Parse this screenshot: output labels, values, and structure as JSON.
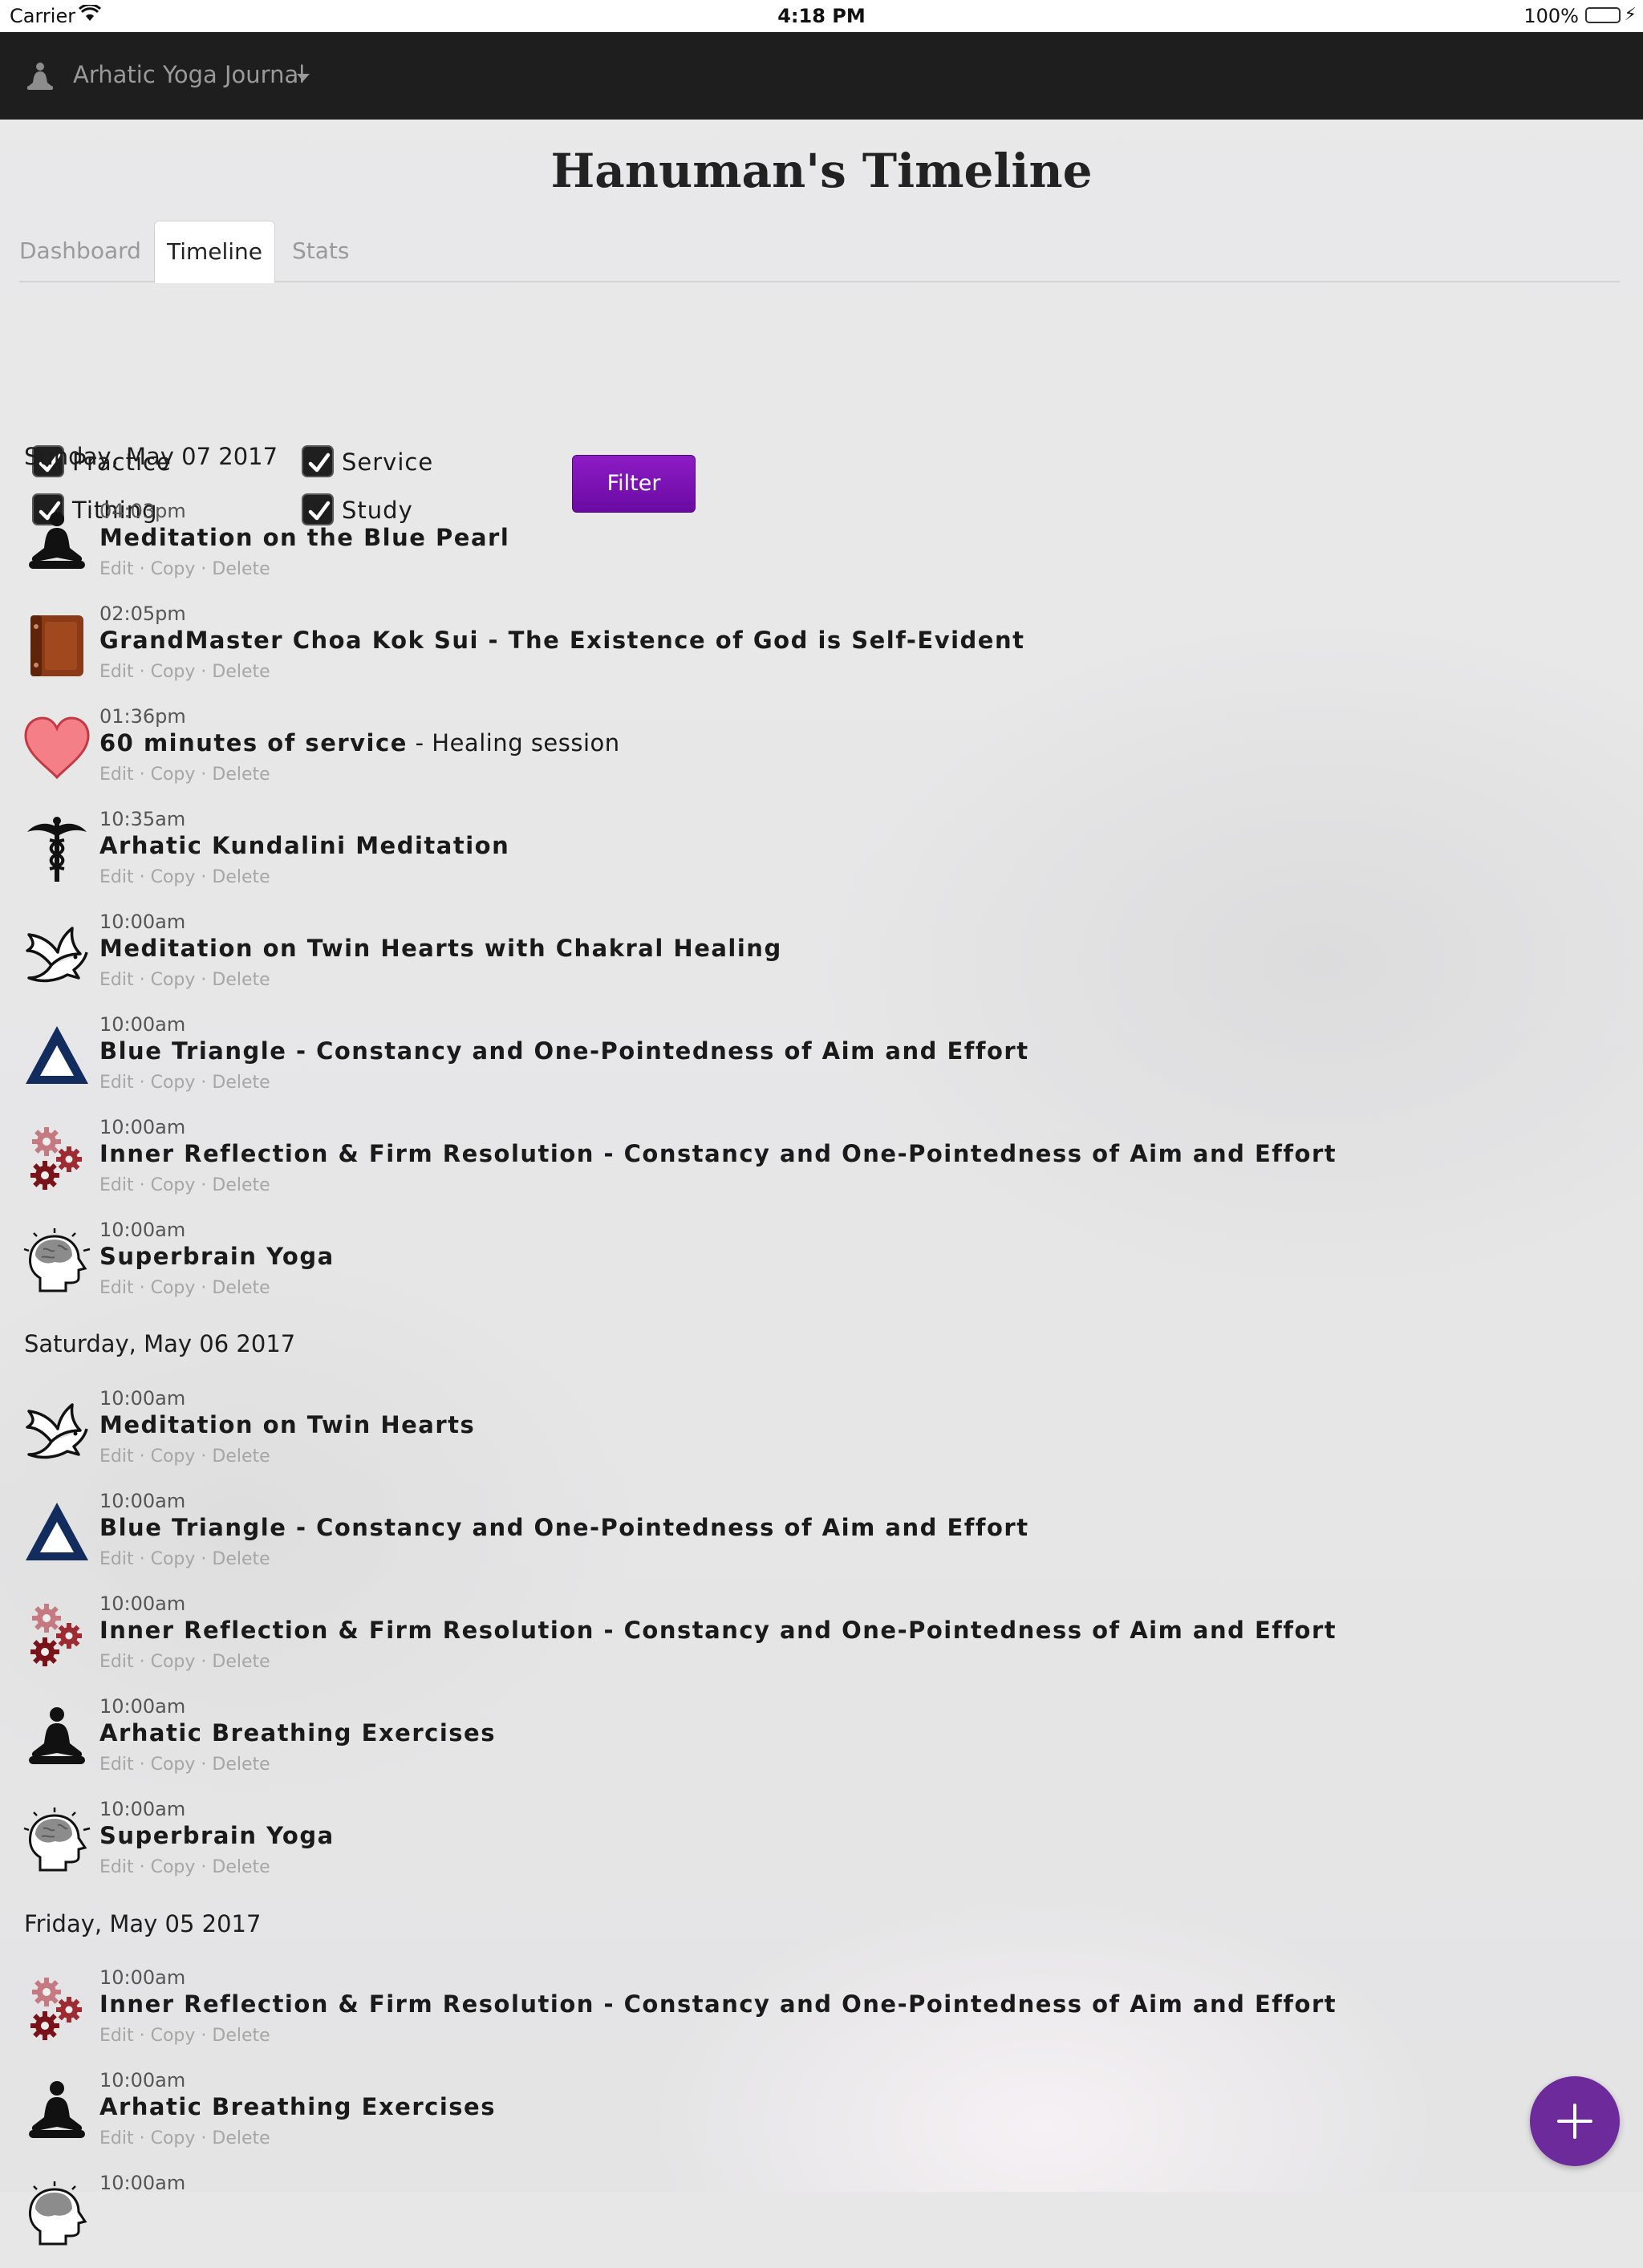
{
  "status_bar": {
    "carrier": "Carrier",
    "time": "4:18 PM",
    "battery": "100%"
  },
  "navbar": {
    "brand": "Arhatic Yoga Journal"
  },
  "page": {
    "title": "Hanuman's Timeline"
  },
  "tabs": [
    {
      "label": "Dashboard"
    },
    {
      "label": "Timeline"
    },
    {
      "label": "Stats"
    }
  ],
  "filters": {
    "practice": "Practice",
    "service": "Service",
    "tithing": "Tithing",
    "study": "Study",
    "button": "Filter"
  },
  "actions": {
    "edit": "Edit",
    "copy": "Copy",
    "delete": "Delete",
    "separator": " · "
  },
  "days": [
    {
      "date": "Sunday, May 07 2017",
      "entries": [
        {
          "icon": "meditation-figure-icon",
          "time": "04:03pm",
          "title": "Meditation on the Blue Pearl",
          "subtitle": ""
        },
        {
          "icon": "book-icon",
          "time": "02:05pm",
          "title": "GrandMaster Choa Kok Sui - The Existence of God is Self-Evident",
          "subtitle": ""
        },
        {
          "icon": "heart-icon",
          "time": "01:36pm",
          "title": "60 minutes of service",
          "subtitle": " - Healing session"
        },
        {
          "icon": "caduceus-icon",
          "time": "10:35am",
          "title": "Arhatic Kundalini Meditation",
          "subtitle": ""
        },
        {
          "icon": "dove-icon",
          "time": "10:00am",
          "title": "Meditation on Twin Hearts with Chakral Healing",
          "subtitle": ""
        },
        {
          "icon": "blue-triangle-icon",
          "time": "10:00am",
          "title": "Blue Triangle - Constancy and One-Pointedness of Aim and Effort",
          "subtitle": ""
        },
        {
          "icon": "gears-icon",
          "time": "10:00am",
          "title": "Inner Reflection & Firm Resolution - Constancy and One-Pointedness of Aim and Effort",
          "subtitle": ""
        },
        {
          "icon": "brain-head-icon",
          "time": "10:00am",
          "title": "Superbrain Yoga",
          "subtitle": ""
        }
      ]
    },
    {
      "date": "Saturday, May 06 2017",
      "entries": [
        {
          "icon": "dove-icon",
          "time": "10:00am",
          "title": "Meditation on Twin Hearts",
          "subtitle": ""
        },
        {
          "icon": "blue-triangle-icon",
          "time": "10:00am",
          "title": "Blue Triangle - Constancy and One-Pointedness of Aim and Effort",
          "subtitle": ""
        },
        {
          "icon": "gears-icon",
          "time": "10:00am",
          "title": "Inner Reflection & Firm Resolution - Constancy and One-Pointedness of Aim and Effort",
          "subtitle": ""
        },
        {
          "icon": "meditation-figure-icon",
          "time": "10:00am",
          "title": "Arhatic Breathing Exercises",
          "subtitle": ""
        },
        {
          "icon": "brain-head-icon",
          "time": "10:00am",
          "title": "Superbrain Yoga",
          "subtitle": ""
        }
      ]
    },
    {
      "date": "Friday, May 05 2017",
      "entries": [
        {
          "icon": "gears-icon",
          "time": "10:00am",
          "title": "Inner Reflection & Firm Resolution - Constancy and One-Pointedness of Aim and Effort",
          "subtitle": ""
        },
        {
          "icon": "meditation-figure-icon",
          "time": "10:00am",
          "title": "Arhatic Breathing Exercises",
          "subtitle": ""
        },
        {
          "icon": "brain-head-icon",
          "time": "10:00am",
          "title": "",
          "subtitle": ""
        }
      ]
    }
  ],
  "colors": {
    "accent": "#6a0aa3",
    "navbar": "#1e1e1e",
    "fab": "#6c2a9b",
    "triangle": "#132c5e",
    "heart": "#f47f86",
    "gear": "#8a1d24"
  }
}
